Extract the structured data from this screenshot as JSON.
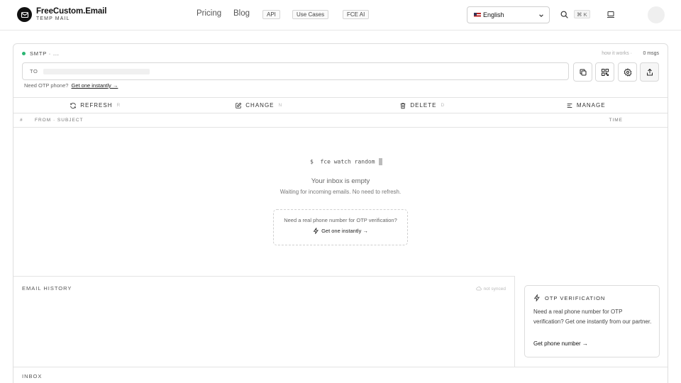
{
  "brand": {
    "name": "FreeCustom.Email",
    "tagline": "TEMP MAIL"
  },
  "nav": {
    "links": [
      "Pricing",
      "Blog"
    ],
    "pills": [
      "API",
      "Use Cases",
      "FCE AI"
    ]
  },
  "language": {
    "selected": "English",
    "flag": "us-flag"
  },
  "search": {
    "shortcut": "⌘ K"
  },
  "mailbox": {
    "status": "SMTP · ...",
    "status_color": "#2bb673",
    "how_it_works": "how it works ·",
    "msg_count": "0 msgs",
    "to_label": "TO",
    "to_value": "",
    "need_otp_text": "Need OTP phone?",
    "need_otp_link": "Get one instantly →"
  },
  "toolbar": {
    "icons": [
      "copy-icon",
      "qr-code-icon",
      "settings-icon",
      "share-icon"
    ]
  },
  "actions": [
    {
      "label": "REFRESH",
      "key": "R",
      "icon": "refresh-icon"
    },
    {
      "label": "CHANGE",
      "key": "N",
      "icon": "edit-icon"
    },
    {
      "label": "DELETE",
      "key": "D",
      "icon": "trash-icon"
    },
    {
      "label": "MANAGE",
      "key": "",
      "icon": "list-icon"
    }
  ],
  "columns": {
    "index": "#",
    "from_subject": "FROM · SUBJECT",
    "time": "TIME"
  },
  "empty_state": {
    "command_prefix": "$",
    "command": "fce watch random",
    "title": "Your inbox is empty",
    "subtitle": "Waiting for incoming emails. No need to refresh.",
    "otp_question": "Need a real phone number for OTP verification?",
    "otp_link": "Get one instantly →"
  },
  "history": {
    "title": "EMAIL HISTORY",
    "sync_status": "not synced"
  },
  "otp_panel": {
    "title": "OTP VERIFICATION",
    "text": "Need a real phone number for OTP verification? Get one instantly from our partner.",
    "link": "Get phone number →"
  },
  "inbox": {
    "title": "INBOX"
  }
}
